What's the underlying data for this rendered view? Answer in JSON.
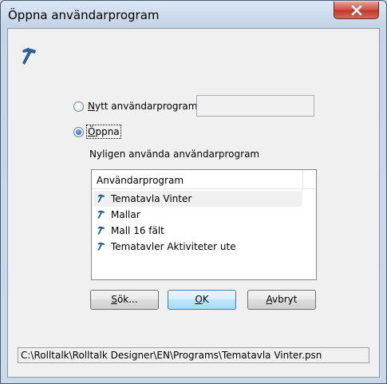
{
  "window": {
    "title": "Öppna användarprogram",
    "close_icon": "close-icon"
  },
  "dialog": {
    "app_icon": "hammer-icon",
    "radio_new": {
      "mnemonic": "N",
      "rest": "ytt användarprogram",
      "checked": false
    },
    "new_name_value": "",
    "radio_open": {
      "mnemonic": "Ö",
      "rest": "ppna",
      "checked": true
    },
    "recent_label": "Nyligen använda användarprogram",
    "list": {
      "column_header": "Användarprogram",
      "items": [
        {
          "label": "Tematavla Vinter",
          "icon": "hammer-icon",
          "selected": true
        },
        {
          "label": "Mallar",
          "icon": "hammer-icon",
          "selected": false
        },
        {
          "label": "Mall 16 fält",
          "icon": "hammer-icon",
          "selected": false
        },
        {
          "label": "Tematavler Aktiviteter ute",
          "icon": "hammer-icon",
          "selected": false
        }
      ]
    },
    "buttons": {
      "browse": {
        "mnemonic": "S",
        "rest": "ök..."
      },
      "ok": {
        "mnemonic": "O",
        "rest": "K"
      },
      "cancel": {
        "mnemonic": "A",
        "rest": "vbryt"
      }
    },
    "status_path": "C:\\Rolltalk\\Rolltalk Designer\\EN\\Programs\\Tematavla Vinter.psn"
  },
  "colors": {
    "accent": "#1a55b3",
    "icon": "#2a5f9e",
    "close_button": "#c0392b"
  }
}
